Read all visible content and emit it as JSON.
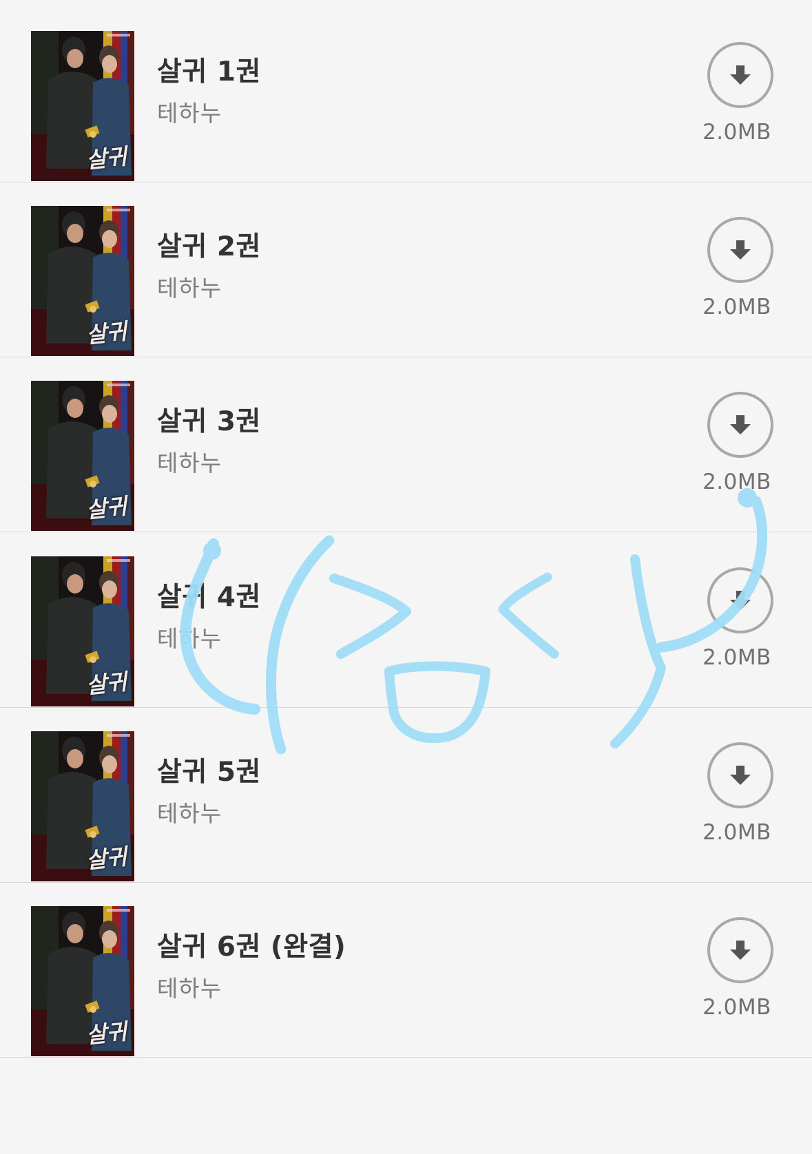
{
  "colors": {
    "background": "#f5f5f5",
    "divider": "#d8d8d8",
    "title_text": "#333333",
    "author_text": "#7c7c7c",
    "download_ring": "#a8a8a8",
    "download_arrow": "#555555",
    "scribble": "#9fdcf7"
  },
  "books": [
    {
      "title": "살귀 1권",
      "author": "테하누",
      "size": "2.0MB",
      "download_icon": "download-arrow-icon"
    },
    {
      "title": "살귀 2권",
      "author": "테하누",
      "size": "2.0MB",
      "download_icon": "download-arrow-icon"
    },
    {
      "title": "살귀 3권",
      "author": "테하누",
      "size": "2.0MB",
      "download_icon": "download-arrow-icon"
    },
    {
      "title": "살귀 4권",
      "author": "테하누",
      "size": "2.0MB",
      "download_icon": "download-arrow-icon"
    },
    {
      "title": "살귀 5권",
      "author": "테하누",
      "size": "2.0MB",
      "download_icon": "download-arrow-icon"
    },
    {
      "title": "살귀 6권 (완결)",
      "author": "테하누",
      "size": "2.0MB",
      "download_icon": "download-arrow-icon"
    }
  ],
  "cover_art": {
    "title_text": "살귀"
  }
}
